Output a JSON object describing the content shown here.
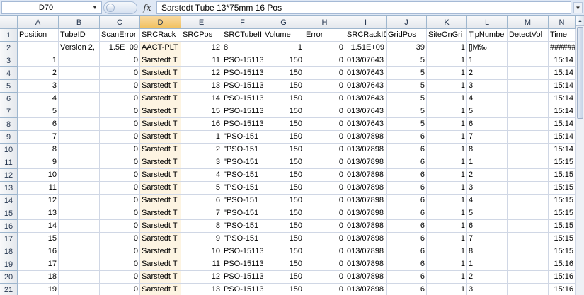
{
  "formula_bar": {
    "name_box": "D70",
    "fx_label": "fx",
    "formula": "Sarstedt Tube 13*75mm 16 Pos"
  },
  "icons": {
    "name_box_dropdown": "chevron-down-icon",
    "formula_expand": "chevron-down-icon",
    "scroll_up": "arrow-up-icon"
  },
  "colors": {
    "selected_column_header": "#f1c15f",
    "selected_cell": "#fdf4e2",
    "gridline": "#d0d7e5",
    "header_text": "#26364f"
  },
  "sheet": {
    "selected_column": "D",
    "column_headers": [
      "A",
      "B",
      "C",
      "D",
      "E",
      "F",
      "G",
      "H",
      "I",
      "J",
      "K",
      "L",
      "M",
      "N"
    ],
    "rows": [
      {
        "n": "1",
        "cells": [
          "Position",
          "TubeID",
          "ScanError",
          "SRCRack",
          "SRCPos",
          "SRCTubeII",
          "Volume",
          "Error",
          "SRCRackID",
          "GridPos",
          "SiteOnGri",
          "TipNumbe",
          "DetectVol",
          "Time"
        ]
      },
      {
        "n": "2",
        "cells": [
          "",
          "Version 2,",
          "1.5E+09",
          "AACT-PLT",
          "12",
          "8",
          "1",
          "0",
          "1.51E+09",
          "39",
          "1",
          "[jM‰",
          "",
          "#######"
        ]
      },
      {
        "n": "3",
        "cells": [
          "1",
          "",
          "0",
          "Sarstedt T",
          "11",
          "PSO-15113",
          "150",
          "0",
          "013/07643",
          "5",
          "1",
          "1",
          "",
          "15:14"
        ]
      },
      {
        "n": "4",
        "cells": [
          "2",
          "",
          "0",
          "Sarstedt T",
          "12",
          "PSO-15113",
          "150",
          "0",
          "013/07643",
          "5",
          "1",
          "2",
          "",
          "15:14"
        ]
      },
      {
        "n": "5",
        "cells": [
          "3",
          "",
          "0",
          "Sarstedt T",
          "13",
          "PSO-15113",
          "150",
          "0",
          "013/07643",
          "5",
          "1",
          "3",
          "",
          "15:14"
        ]
      },
      {
        "n": "6",
        "cells": [
          "4",
          "",
          "0",
          "Sarstedt T",
          "14",
          "PSO-15113",
          "150",
          "0",
          "013/07643",
          "5",
          "1",
          "4",
          "",
          "15:14"
        ]
      },
      {
        "n": "7",
        "cells": [
          "5",
          "",
          "0",
          "Sarstedt T",
          "15",
          "PSO-15113",
          "150",
          "0",
          "013/07643",
          "5",
          "1",
          "5",
          "",
          "15:14"
        ]
      },
      {
        "n": "8",
        "cells": [
          "6",
          "",
          "0",
          "Sarstedt T",
          "16",
          "PSO-15113",
          "150",
          "0",
          "013/07643",
          "5",
          "1",
          "6",
          "",
          "15:14"
        ]
      },
      {
        "n": "9",
        "cells": [
          "7",
          "",
          "0",
          "Sarstedt T",
          "1",
          "\"PSO-151",
          "150",
          "0",
          "013/07898",
          "6",
          "1",
          "7",
          "",
          "15:14"
        ]
      },
      {
        "n": "10",
        "cells": [
          "8",
          "",
          "0",
          "Sarstedt T",
          "2",
          "\"PSO-151",
          "150",
          "0",
          "013/07898",
          "6",
          "1",
          "8",
          "",
          "15:14"
        ]
      },
      {
        "n": "11",
        "cells": [
          "9",
          "",
          "0",
          "Sarstedt T",
          "3",
          "\"PSO-151",
          "150",
          "0",
          "013/07898",
          "6",
          "1",
          "1",
          "",
          "15:15"
        ]
      },
      {
        "n": "12",
        "cells": [
          "10",
          "",
          "0",
          "Sarstedt T",
          "4",
          "\"PSO-151",
          "150",
          "0",
          "013/07898",
          "6",
          "1",
          "2",
          "",
          "15:15"
        ]
      },
      {
        "n": "13",
        "cells": [
          "11",
          "",
          "0",
          "Sarstedt T",
          "5",
          "\"PSO-151",
          "150",
          "0",
          "013/07898",
          "6",
          "1",
          "3",
          "",
          "15:15"
        ]
      },
      {
        "n": "14",
        "cells": [
          "12",
          "",
          "0",
          "Sarstedt T",
          "6",
          "\"PSO-151",
          "150",
          "0",
          "013/07898",
          "6",
          "1",
          "4",
          "",
          "15:15"
        ]
      },
      {
        "n": "15",
        "cells": [
          "13",
          "",
          "0",
          "Sarstedt T",
          "7",
          "\"PSO-151",
          "150",
          "0",
          "013/07898",
          "6",
          "1",
          "5",
          "",
          "15:15"
        ]
      },
      {
        "n": "16",
        "cells": [
          "14",
          "",
          "0",
          "Sarstedt T",
          "8",
          "\"PSO-151",
          "150",
          "0",
          "013/07898",
          "6",
          "1",
          "6",
          "",
          "15:15"
        ]
      },
      {
        "n": "17",
        "cells": [
          "15",
          "",
          "0",
          "Sarstedt T",
          "9",
          "\"PSO-151",
          "150",
          "0",
          "013/07898",
          "6",
          "1",
          "7",
          "",
          "15:15"
        ]
      },
      {
        "n": "18",
        "cells": [
          "16",
          "",
          "0",
          "Sarstedt T",
          "10",
          "PSO-15113",
          "150",
          "0",
          "013/07898",
          "6",
          "1",
          "8",
          "",
          "15:15"
        ]
      },
      {
        "n": "19",
        "cells": [
          "17",
          "",
          "0",
          "Sarstedt T",
          "11",
          "PSO-15113",
          "150",
          "0",
          "013/07898",
          "6",
          "1",
          "1",
          "",
          "15:16"
        ]
      },
      {
        "n": "20",
        "cells": [
          "18",
          "",
          "0",
          "Sarstedt T",
          "12",
          "PSO-15113",
          "150",
          "0",
          "013/07898",
          "6",
          "1",
          "2",
          "",
          "15:16"
        ]
      },
      {
        "n": "21",
        "cells": [
          "19",
          "",
          "0",
          "Sarstedt T",
          "13",
          "PSO-15113",
          "150",
          "0",
          "013/07898",
          "6",
          "1",
          "3",
          "",
          "15:16"
        ]
      }
    ]
  }
}
